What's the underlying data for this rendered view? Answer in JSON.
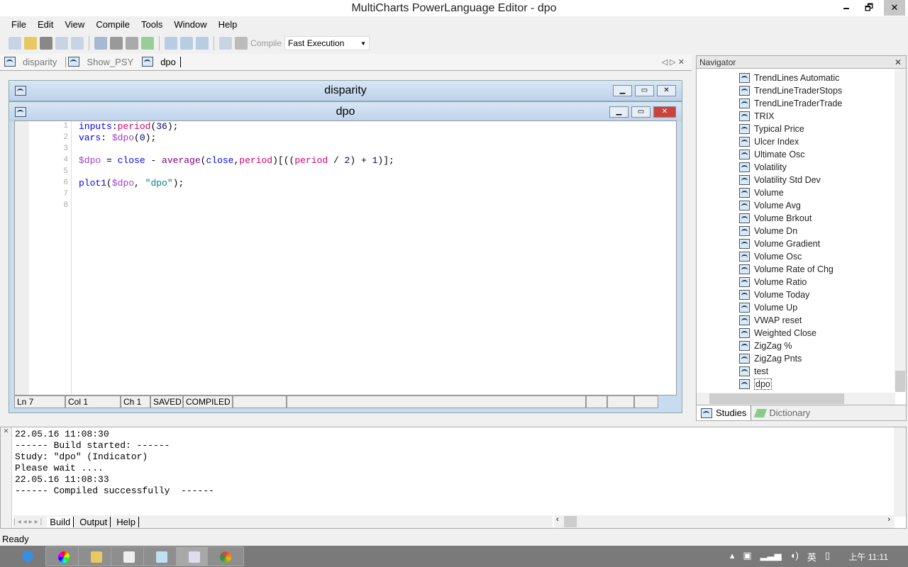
{
  "window": {
    "title": "MultiCharts PowerLanguage Editor - dpo",
    "minimize": "🗕",
    "restore": "🗗",
    "close": "✕"
  },
  "menu": [
    "File",
    "Edit",
    "View",
    "Compile",
    "Tools",
    "Window",
    "Help"
  ],
  "toolbar": {
    "compile_label": "Compile",
    "mode": "Fast Execution"
  },
  "tabs": [
    "disparity",
    "Show_PSY",
    "dpo"
  ],
  "windows": {
    "back_title": "disparity",
    "front_title": "dpo"
  },
  "code": {
    "line_numbers": [
      "1",
      "2",
      "3",
      "4",
      "5",
      "6",
      "7",
      "8"
    ]
  },
  "status": {
    "ln": "Ln 7",
    "col": "Col 1",
    "ch": "Ch 1",
    "saved": "SAVED",
    "compiled": "COMPILED"
  },
  "navigator": {
    "title": "Navigator",
    "items": [
      "TrendLines Automatic",
      "TrendLineTraderStops",
      "TrendLineTraderTrade",
      "TRIX",
      "Typical Price",
      "Ulcer Index",
      "Ultimate Osc",
      "Volatility",
      "Volatility Std Dev",
      "Volume",
      "Volume Avg",
      "Volume Brkout",
      "Volume Dn",
      "Volume Gradient",
      "Volume Osc",
      "Volume Rate of Chg",
      "Volume Ratio",
      "Volume Today",
      "Volume Up",
      "VWAP reset",
      "Weighted Close",
      "ZigZag %",
      "ZigZag Pnts",
      "test",
      "dpo"
    ],
    "tabs": [
      "Studies",
      "Dictionary"
    ]
  },
  "output": {
    "lines": [
      "22.05.16 11:08:30",
      "------ Build started: ------",
      "Study: \"dpo\" (Indicator)",
      "Please wait ....",
      "22.05.16 11:08:33",
      "------ Compiled successfully  ------"
    ],
    "tabs": [
      "Build",
      "Output",
      "Help"
    ]
  },
  "statusbar": {
    "text": "Ready"
  },
  "taskbar": {
    "ime": "英",
    "clock": "上午 11:11"
  }
}
